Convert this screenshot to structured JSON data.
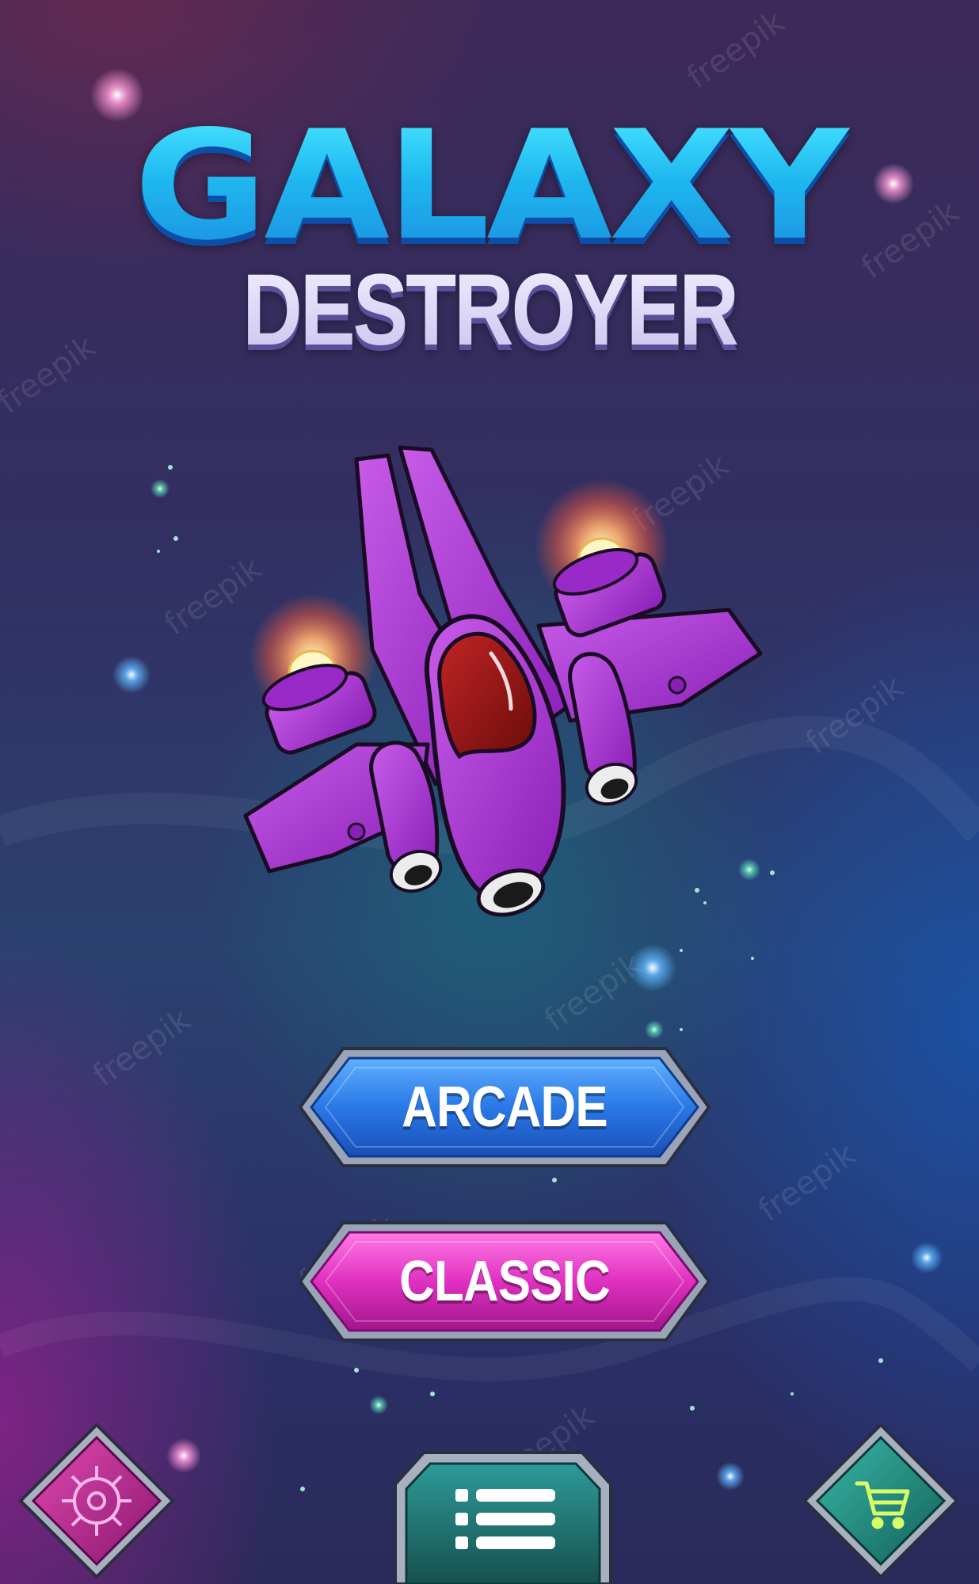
{
  "title": {
    "line1": "GALAXY",
    "line2": "DESTROYER"
  },
  "menu": {
    "arcade_label": "ARCADE",
    "classic_label": "CLASSIC"
  },
  "bottom_bar": {
    "settings_icon": "gear-icon",
    "menu_icon": "list-menu-icon",
    "shop_icon": "shopping-cart-icon"
  },
  "watermark": "freepik",
  "colors": {
    "arcade_button": "#2a78e6",
    "classic_button": "#e030c0",
    "ship_body": "#a52bd0",
    "title_galaxy": "#1ec8f5",
    "title_destroyer": "#d6d2f2",
    "settings_tile": "#c0308f",
    "menu_tile": "#1f6e70",
    "shop_tile": "#1f8a80"
  }
}
